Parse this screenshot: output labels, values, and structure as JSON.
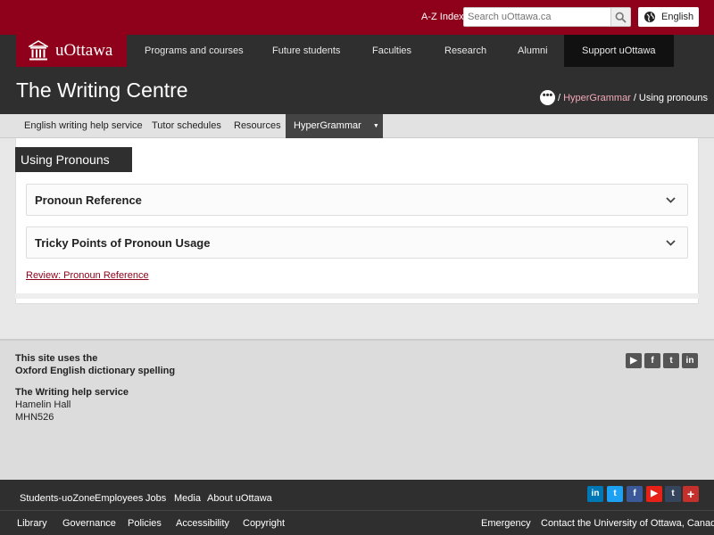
{
  "topbar": {
    "az_index": "A-Z Index",
    "search_placeholder": "Search uOttawa.ca",
    "language": "English"
  },
  "brand": {
    "logo_text": "uOttawa",
    "color": "#8f001a"
  },
  "mainnav": {
    "items": [
      "Programs and courses",
      "Future students",
      "Faculties",
      "Research",
      "Alumni",
      "Support uOttawa"
    ]
  },
  "site": {
    "title": "The Writing Centre",
    "breadcrumb": {
      "separator": "/",
      "link": "HyperGrammar",
      "current": "Using pronouns"
    }
  },
  "subnav": {
    "items": [
      "English writing help service",
      "Tutor schedules",
      "Resources",
      "HyperGrammar"
    ]
  },
  "main": {
    "page_tag": "Using Pronouns",
    "accordions": [
      "Pronoun Reference",
      "Tricky Points of Pronoun Usage"
    ],
    "review_link": "Review: Pronoun Reference"
  },
  "footer": {
    "spelling_line1": "This site uses the",
    "spelling_line2": "Oxford English dictionary spelling",
    "service_title": "The Writing help service",
    "address_line1": "Hamelin Hall",
    "address_line2": "MHN526",
    "social_top": [
      "youtube-icon",
      "facebook-icon",
      "twitter-icon",
      "linkedin-icon"
    ]
  },
  "bottombar": {
    "row1": [
      "Students-uoZone",
      "Employees",
      "Jobs",
      "Media",
      "About uOttawa"
    ],
    "row2": [
      "Library",
      "Governance",
      "Policies",
      "Accessibility",
      "Copyright"
    ],
    "emergency": "Emergency",
    "contact": "Contact the University of Ottawa, Canada",
    "social": [
      "linkedin-icon",
      "twitter-icon",
      "facebook-icon",
      "youtube-icon",
      "tumblr-icon",
      "plus-icon"
    ]
  }
}
